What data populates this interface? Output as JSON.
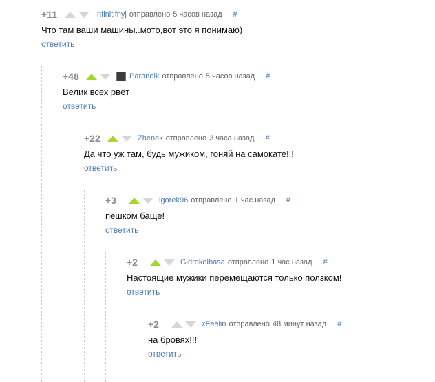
{
  "comments": [
    {
      "rating": "+11",
      "author": "Infinitifnyj",
      "sent": "отправлено",
      "time": "5 часов назад",
      "hash": "#",
      "text": "Что там ваши машины..мото,вот это я понимаю)",
      "reply": "ответить",
      "upvoted": false,
      "has_avatar": false
    },
    {
      "rating": "+48",
      "author": "Paranoik",
      "sent": "отправлено",
      "time": "5 часов назад",
      "hash": "#",
      "text": "Велик всех рвёт",
      "reply": "ответить",
      "upvoted": true,
      "has_avatar": true
    },
    {
      "rating": "+22",
      "author": "Zhenek",
      "sent": "отправлено",
      "time": "3 часа назад",
      "hash": "#",
      "text": "Да что уж там, будь мужиком, гоняй на самокате!!!",
      "reply": "ответить",
      "upvoted": true,
      "has_avatar": false
    },
    {
      "rating": "+3",
      "author": "igorek96",
      "sent": "отправлено",
      "time": "1 час назад",
      "hash": "#",
      "text": "пешком баще!",
      "reply": "ответить",
      "upvoted": true,
      "has_avatar": false
    },
    {
      "rating": "+2",
      "author": "Gidrokolbasa",
      "sent": "отправлено",
      "time": "1 час назад",
      "hash": "#",
      "text": "Настоящие мужики перемещаются только ползком!",
      "reply": "ответить",
      "upvoted": true,
      "has_avatar": false
    },
    {
      "rating": "+2",
      "author": "xFeelin",
      "sent": "отправлено",
      "time": "48 минут назад",
      "hash": "#",
      "text": "на бровях!!!",
      "reply": "ответить",
      "upvoted": false,
      "has_avatar": false
    }
  ]
}
